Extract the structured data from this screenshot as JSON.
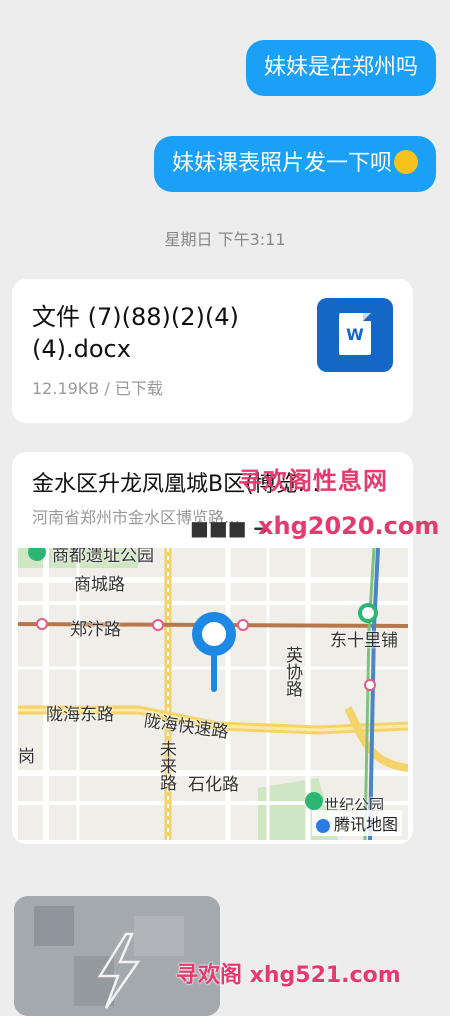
{
  "messages": [
    {
      "text": "妹妹是在郑州吗"
    },
    {
      "text": "妹妹课表照片发一下呗"
    }
  ],
  "timestamp": "星期日 下午3:11",
  "file": {
    "name": "文件 (7)(88)(2)(4)(4).docx",
    "size": "12.19KB",
    "status": "已下载",
    "icon": "word-doc-icon",
    "icon_letter": "W"
  },
  "location": {
    "title": "金水区升龙凤凰城B区(博览…",
    "address": "河南省郑州市金水区博览路…",
    "map_labels": {
      "top": "商都遗址公园",
      "shangcheng": "商城路",
      "zhengbian": "郑汴路",
      "dongshili": "东十里铺",
      "yingxie": "英协路",
      "longhai_e": "陇海东路",
      "longhai_exp": "陇海快速路",
      "weilai": "未来路",
      "shihua": "石化路",
      "park": "世纪公园",
      "left_edge": "岗",
      "brand": "腾讯地图"
    }
  },
  "watermarks": {
    "w1": "寻欢阁性息网",
    "w2": "xhg2020.com",
    "w3": "寻欢阁 xhg521.com",
    "arrow": "■■■ ➜"
  },
  "colors": {
    "bubble": "#1aa1f7",
    "background": "#ededed",
    "watermark": "#e53a6e",
    "map_pin": "#1e88e5"
  }
}
